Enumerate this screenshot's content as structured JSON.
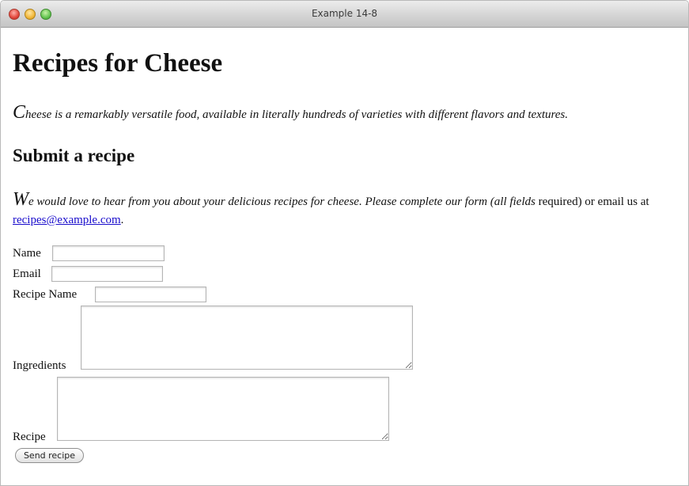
{
  "window": {
    "title": "Example 14-8"
  },
  "page": {
    "heading": "Recipes for Cheese",
    "lede_dropcap": "C",
    "lede_rest": "heese is a remarkably versatile food, available in literally hundreds of varieties with different flavors and textures.",
    "subheading": "Submit a recipe",
    "intro_dropcap": "W",
    "intro_italic": "e would love to hear from you about your delicious recipes for cheese. Please complete our form (all fields",
    "intro_plain": "required) or email us at",
    "email_link": "recipes@example.com",
    "intro_end": "."
  },
  "form": {
    "name_label": "Name",
    "name_value": "",
    "email_label": "Email",
    "email_value": "",
    "recipe_name_label": "Recipe Name",
    "recipe_name_value": "",
    "ingredients_label": "Ingredients",
    "ingredients_value": "",
    "recipe_label": "Recipe",
    "recipe_value": "",
    "submit_label": "Send recipe"
  }
}
